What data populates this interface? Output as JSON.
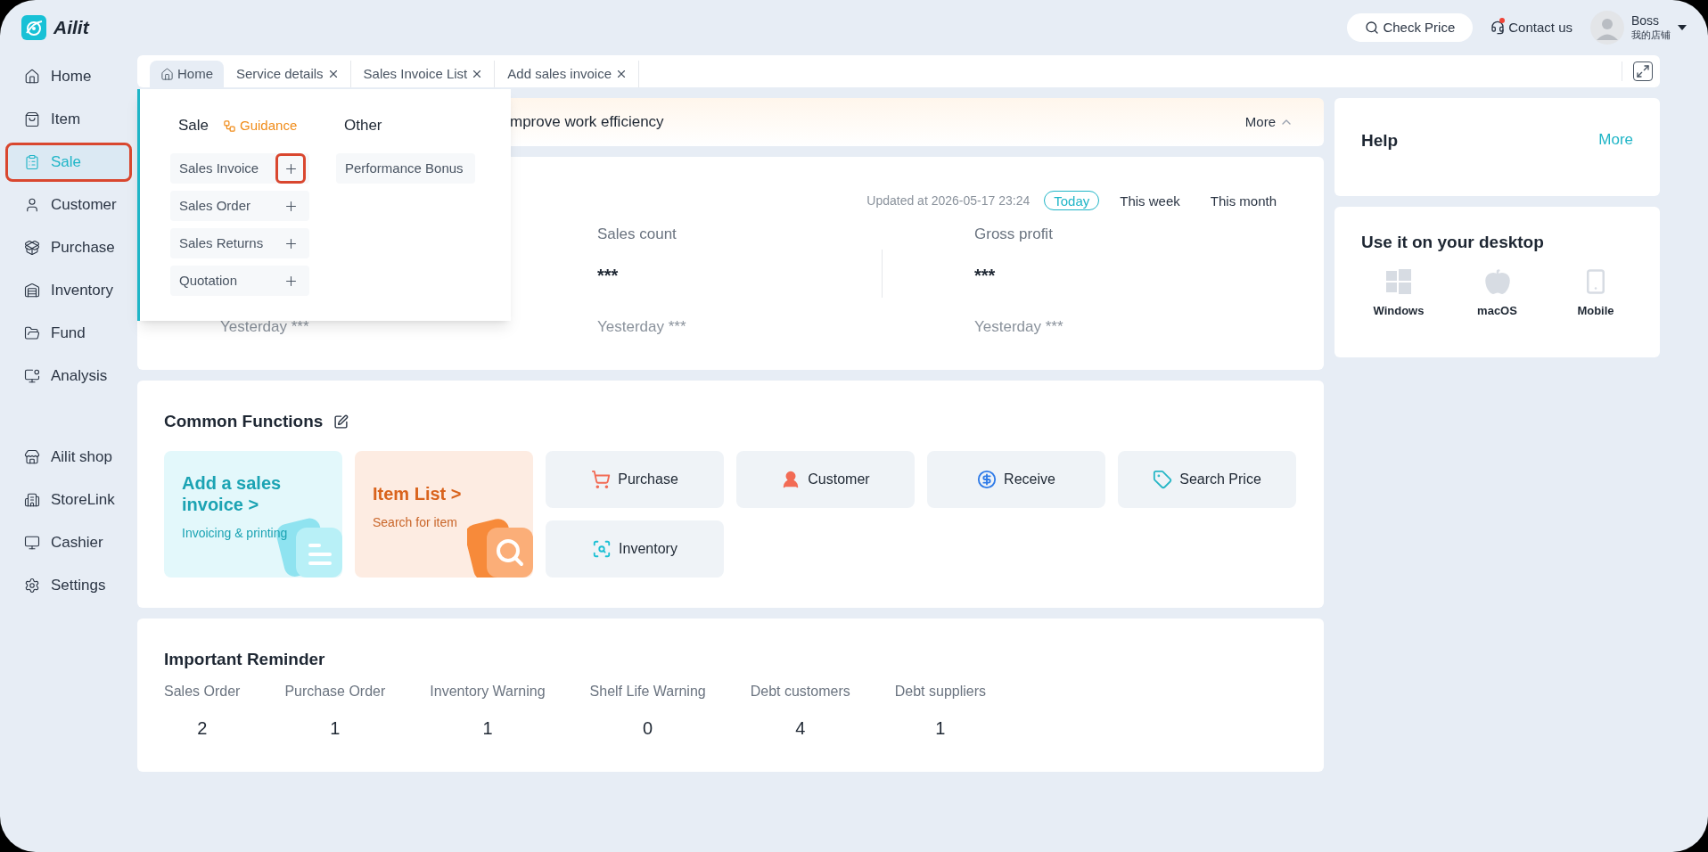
{
  "app": {
    "name": "Ailit"
  },
  "header": {
    "check_price": "Check Price",
    "contact": "Contact us",
    "contact_notification": true,
    "user": {
      "name": "Boss",
      "store": "我的店铺"
    }
  },
  "sidebar": {
    "sections": [
      {
        "items": [
          {
            "kind": "home",
            "label": "Home",
            "selected": false,
            "annotated": false
          },
          {
            "kind": "item",
            "label": "Item",
            "selected": false,
            "annotated": false
          },
          {
            "kind": "sale",
            "label": "Sale",
            "selected": true,
            "annotated": true
          },
          {
            "kind": "customer",
            "label": "Customer",
            "selected": false,
            "annotated": false
          },
          {
            "kind": "purchase",
            "label": "Purchase",
            "selected": false,
            "annotated": false
          },
          {
            "kind": "inventory",
            "label": "Inventory",
            "selected": false,
            "annotated": false
          },
          {
            "kind": "fund",
            "label": "Fund",
            "selected": false,
            "annotated": false
          },
          {
            "kind": "analysis",
            "label": "Analysis",
            "selected": false,
            "annotated": false
          }
        ]
      },
      {
        "items": [
          {
            "kind": "shop",
            "label": "Ailit shop",
            "selected": false,
            "annotated": false
          },
          {
            "kind": "storelink",
            "label": "StoreLink",
            "selected": false,
            "annotated": false
          },
          {
            "kind": "cashier",
            "label": "Cashier",
            "selected": false,
            "annotated": false
          },
          {
            "kind": "settings",
            "label": "Settings",
            "selected": false,
            "annotated": false
          }
        ]
      }
    ]
  },
  "tabs": [
    {
      "label": "Home",
      "selected": true,
      "closable": false
    },
    {
      "label": "Service details",
      "selected": false,
      "closable": true
    },
    {
      "label": "Sales Invoice List",
      "selected": false,
      "closable": true
    },
    {
      "label": "Add sales invoice",
      "selected": false,
      "closable": true
    }
  ],
  "dropdown": {
    "columns": [
      {
        "title": "Sale",
        "guidance": "Guidance",
        "items": [
          {
            "label": "Sales Invoice",
            "addable": true,
            "annotated": true
          },
          {
            "label": "Sales Order",
            "addable": true,
            "annotated": false
          },
          {
            "label": "Sales Returns",
            "addable": true,
            "annotated": false
          },
          {
            "label": "Quotation",
            "addable": true,
            "annotated": false
          }
        ]
      },
      {
        "title": "Other",
        "items": [
          {
            "label": "Performance Bonus",
            "addable": false,
            "annotated": false
          }
        ]
      }
    ]
  },
  "banner": {
    "text": "mprove work efficiency",
    "more": "More"
  },
  "sales_summary": {
    "updated": "Updated at 2026-05-17 23:24",
    "periods": [
      {
        "label": "Today",
        "selected": true
      },
      {
        "label": "This week",
        "selected": false
      },
      {
        "label": "This month",
        "selected": false
      }
    ],
    "metrics": [
      {
        "yesterday": "Yesterday ***"
      },
      {
        "label": "Sales count",
        "value": "***",
        "yesterday": "Yesterday ***"
      },
      {
        "label": "Gross profit",
        "value": "***",
        "yesterday": "Yesterday ***"
      }
    ]
  },
  "common_functions": {
    "title": "Common Functions",
    "features": [
      {
        "kind": "invoice",
        "title": "Add a sales invoice >",
        "subtitle": "Invoicing & printing"
      },
      {
        "kind": "items",
        "title": "Item List >",
        "subtitle": "Search for item"
      }
    ],
    "shortcuts": [
      {
        "kind": "purchase",
        "label": "Purchase"
      },
      {
        "kind": "customer",
        "label": "Customer"
      },
      {
        "kind": "receive",
        "label": "Receive"
      },
      {
        "kind": "search_price",
        "label": "Search Price"
      },
      {
        "kind": "inventory",
        "label": "Inventory"
      }
    ]
  },
  "reminder": {
    "title": "Important Reminder",
    "items": [
      {
        "label": "Sales Order",
        "count": "2"
      },
      {
        "label": "Purchase Order",
        "count": "1"
      },
      {
        "label": "Inventory Warning",
        "count": "1"
      },
      {
        "label": "Shelf Life Warning",
        "count": "0"
      },
      {
        "label": "Debt customers",
        "count": "4"
      },
      {
        "label": "Debt suppliers",
        "count": "1"
      }
    ]
  },
  "help": {
    "title": "Help",
    "more": "More"
  },
  "desktop": {
    "title": "Use it on your desktop",
    "platforms": [
      {
        "kind": "windows",
        "label": "Windows"
      },
      {
        "kind": "macos",
        "label": "macOS"
      },
      {
        "kind": "mobile",
        "label": "Mobile"
      }
    ]
  }
}
